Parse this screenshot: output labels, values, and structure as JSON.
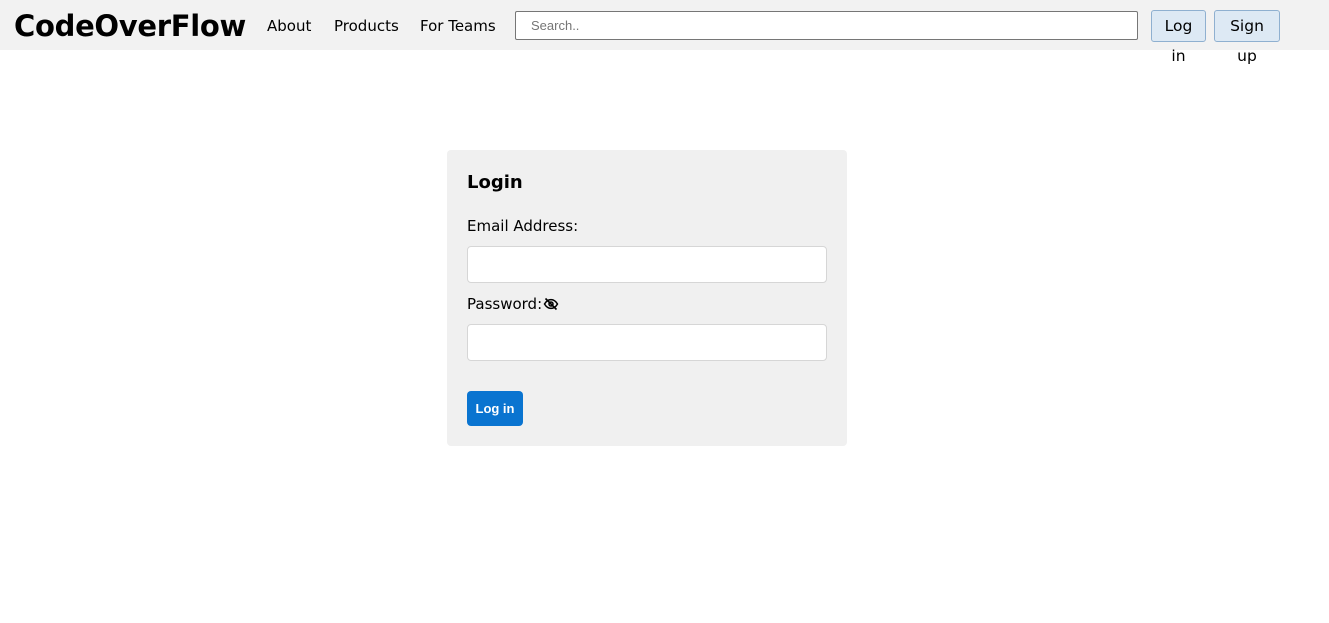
{
  "header": {
    "brand": "CodeOverFlow",
    "nav": {
      "about": "About",
      "products": "Products",
      "teams": "For Teams"
    },
    "search": {
      "placeholder": "Search..",
      "value": ""
    },
    "login_label": "Log in",
    "signup_label": "Sign up"
  },
  "login_form": {
    "title": "Login",
    "email_label": "Email Address:",
    "email_value": "",
    "password_label": "Password:",
    "password_value": "",
    "password_toggle_icon": "eye-slash-icon",
    "submit_label": "Log in"
  },
  "colors": {
    "navbar_bg": "#f2f2f2",
    "card_bg": "#f0f0f0",
    "primary": "#0a74d0",
    "header_button_bg": "#dde9f4"
  }
}
